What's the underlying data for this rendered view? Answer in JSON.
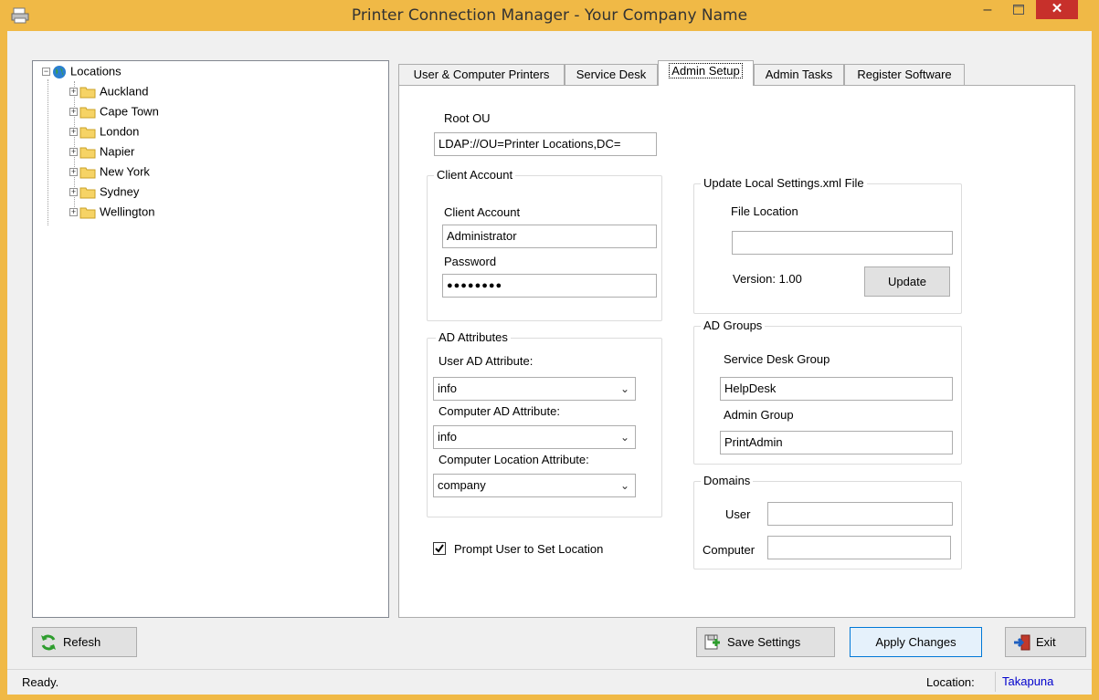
{
  "window": {
    "title": "Printer Connection Manager - Your Company Name",
    "minimize_glyph": "–",
    "close_glyph": "✕"
  },
  "tree": {
    "root": "Locations",
    "items": [
      "Auckland",
      "Cape Town",
      "London",
      "Napier",
      "New York",
      "Sydney",
      "Wellington"
    ]
  },
  "tabs": [
    "User & Computer Printers",
    "Service Desk",
    "Admin Setup",
    "Admin Tasks",
    "Register Software"
  ],
  "active_tab": "Admin Setup",
  "admin_setup": {
    "root_ou_label": "Root OU",
    "root_ou_value": "LDAP://OU=Printer Locations,DC=",
    "client_account": {
      "group_title": "Client Account",
      "account_label": "Client Account",
      "account_value": "Administrator",
      "password_label": "Password",
      "password_value": "●●●●●●●●"
    },
    "ad_attributes": {
      "group_title": "AD Attributes",
      "user_label": "User AD Attribute:",
      "user_value": "info",
      "computer_label": "Computer AD Attribute:",
      "computer_value": "info",
      "location_label": "Computer Location Attribute:",
      "location_value": "company"
    },
    "prompt_checkbox_label": "Prompt User to Set Location",
    "prompt_checked": true,
    "update_settings": {
      "group_title": "Update Local Settings.xml File",
      "file_location_label": "File Location",
      "file_location_value": "",
      "version_label": "Version: 1.00",
      "update_button": "Update"
    },
    "ad_groups": {
      "group_title": "AD Groups",
      "service_desk_label": "Service Desk Group",
      "service_desk_value": "HelpDesk",
      "admin_label": "Admin Group",
      "admin_value": "PrintAdmin"
    },
    "domains": {
      "group_title": "Domains",
      "user_label": "User",
      "user_value": "",
      "computer_label": "Computer",
      "computer_value": ""
    }
  },
  "buttons": {
    "refresh": "Refesh",
    "save_settings": "Save Settings",
    "apply_changes": "Apply Changes",
    "exit": "Exit"
  },
  "status": {
    "text": "Ready.",
    "location_label": "Location:",
    "location_value": "Takapuna"
  },
  "colors": {
    "title_bar": "#f0b946",
    "close_button": "#c7302b",
    "location_value": "#0000cc"
  }
}
